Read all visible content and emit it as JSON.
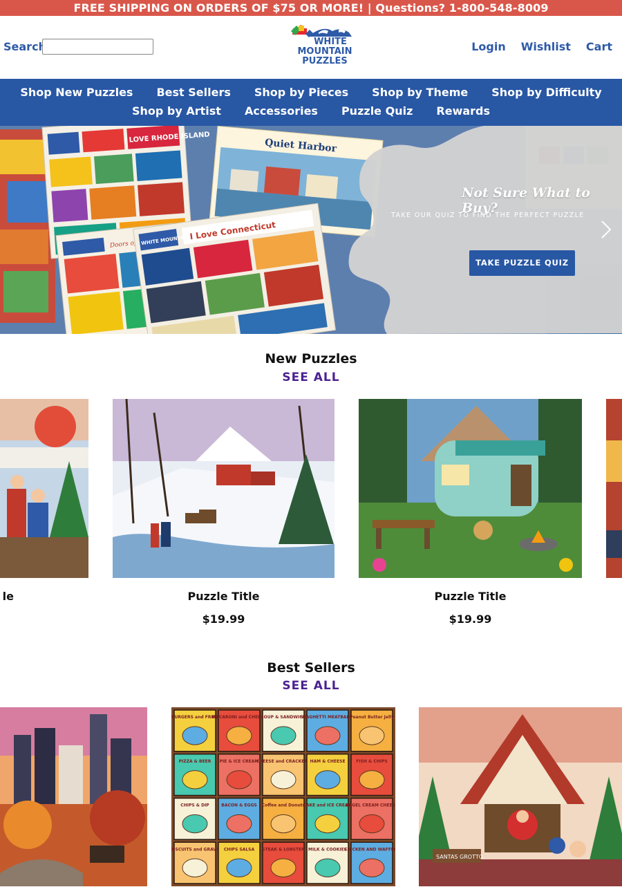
{
  "promo": {
    "text": "FREE SHIPPING ON ORDERS OF $75 OR MORE! | Questions? 1-800-548-8009"
  },
  "header": {
    "search_label": "Search",
    "search_value": "",
    "logo": {
      "line1": "WHITE",
      "line2": "MOUNTAIN",
      "line3": "PUZZLES",
      "icon": "puzzle-pieces-icon"
    },
    "links": [
      "Login",
      "Wishlist",
      "Cart"
    ]
  },
  "nav": {
    "row1": [
      "Shop New Puzzles",
      "Best Sellers",
      "Shop by Pieces",
      "Shop by Theme",
      "Shop by Difficulty"
    ],
    "row2": [
      "Shop by Artist",
      "Accessories",
      "Puzzle Quiz",
      "Rewards"
    ]
  },
  "hero": {
    "heading": "Not Sure What to Buy?",
    "subheading": "TAKE OUR QUIZ TO FIND THE PERFECT PUZZLE",
    "button": "TAKE PUZZLE QUIZ",
    "next_icon": "chevron-right-icon",
    "box_labels": {
      "quiet_harbor": "Quiet Harbor",
      "connecticut": "I Love Connecticut",
      "rhode_island": "I LOVE RHODE ISLAND",
      "doors": "Doors of the World",
      "brand": "WHITE MOUNTAIN"
    }
  },
  "new_puzzles": {
    "title": "New Puzzles",
    "see_all": "SEE ALL",
    "items": [
      {
        "title": "Puzzle Title",
        "price": "$19.99",
        "partial_title": "le"
      },
      {
        "title": "Puzzle Title",
        "price": "$19.99"
      },
      {
        "title": "Puzzle Title",
        "price": "$19.99"
      }
    ]
  },
  "best_sellers": {
    "title": "Best Sellers",
    "see_all": "SEE ALL",
    "tiles": [
      "BURGERS and FRIES",
      "MACARONI and CHEESE",
      "SOUP & SANDWICH",
      "SPAGHETTI MEATBALLS",
      "Peanut Butter Jelly",
      "PIZZA & BEER",
      "PIE & ICE CREAM",
      "CHEESE and CRACKERS",
      "HAM & CHEESE",
      "FISH & CHIPS",
      "CHIPS & DIP",
      "BACON & EGGS",
      "Coffee and Donuts",
      "CAKE and ICE CREAM",
      "BAGEL CREAM CHEESE",
      "BISCUITS and GRAVY",
      "CHIPS SALSA",
      "STEAK & LOBSTER",
      "MILK & COOKIES",
      "CHICKEN AND WAFFLES"
    ],
    "sign": "SANTAS GROTTO"
  }
}
